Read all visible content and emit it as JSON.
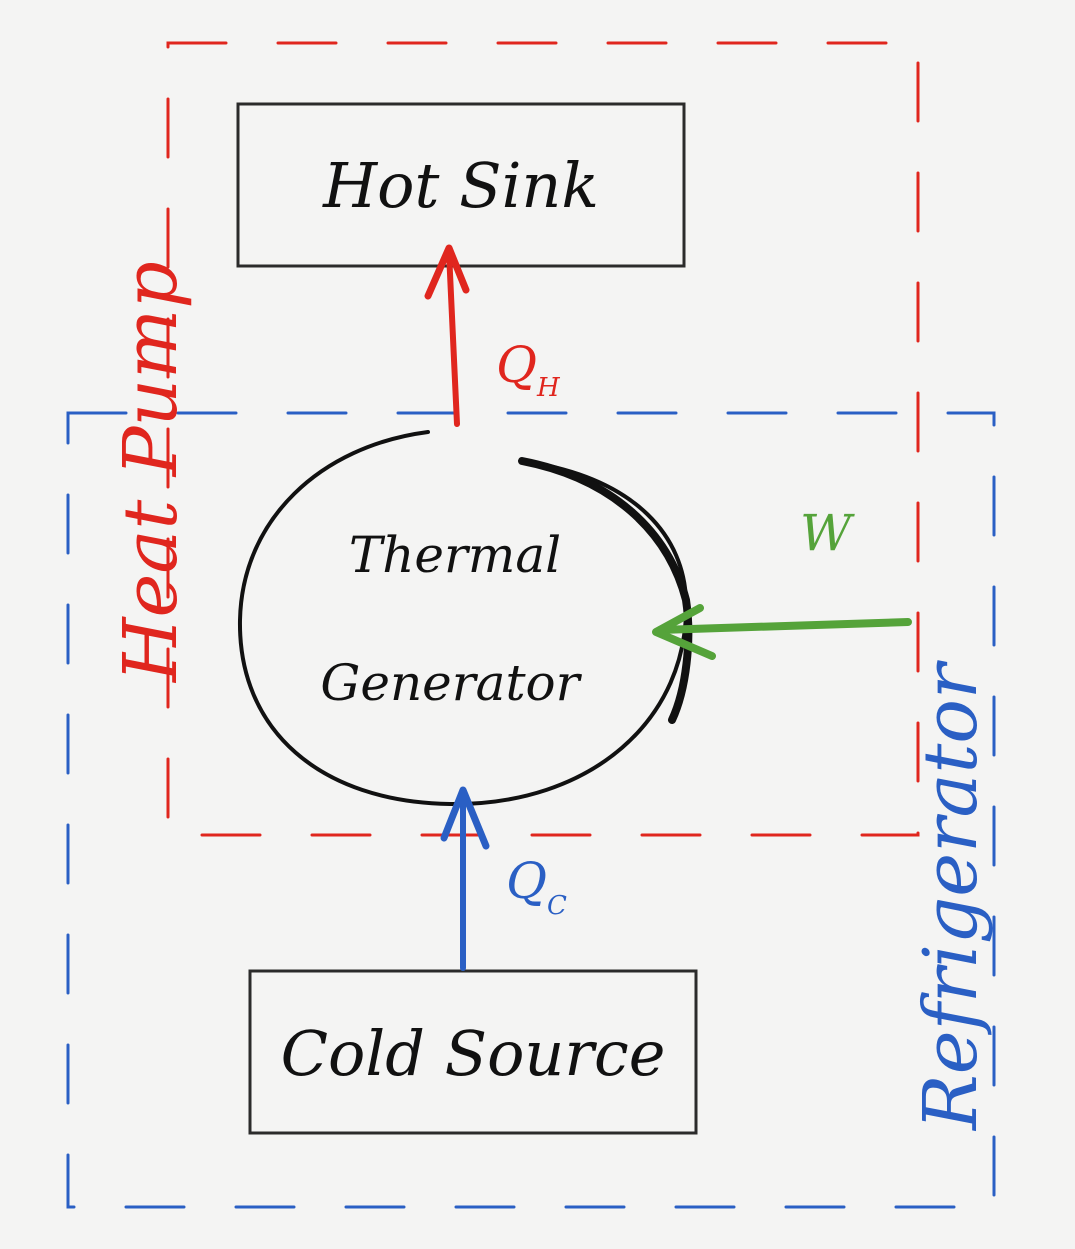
{
  "diagram": {
    "hot_sink": {
      "label": "Hot Sink"
    },
    "cold_source": {
      "label": "Cold Source"
    },
    "generator": {
      "line1": "Thermal",
      "line2": "Generator"
    },
    "heat_hot": {
      "symbol": "Q",
      "subscript": "H"
    },
    "heat_cold": {
      "symbol": "Q",
      "subscript": "C"
    },
    "work": {
      "symbol": "W"
    },
    "heat_pump_region": {
      "label": "Heat Pump"
    },
    "refrigerator_region": {
      "label": "Refrigerator"
    }
  },
  "colors": {
    "heat_pump": "#e0261e",
    "refrigerator": "#2a5fc4",
    "work": "#55a33a",
    "ink": "#111111",
    "background": "#f4f4f3"
  }
}
